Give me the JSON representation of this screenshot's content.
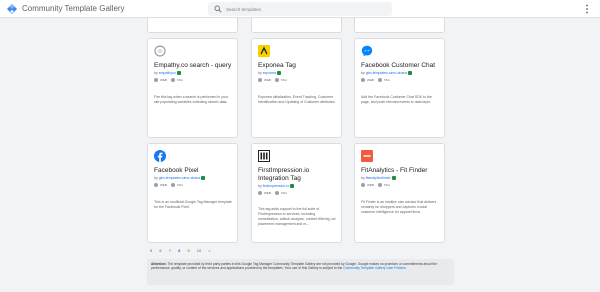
{
  "header": {
    "title": "Community Template Gallery",
    "search_placeholder": "Search templates"
  },
  "cards": [
    {
      "title": "Empathy.co search - query",
      "by": "by",
      "author": "empathyco",
      "tags": [
        "WEB",
        "TAG"
      ],
      "description": "Fire this tag when a search is performed in your site populating variables collecting search data.",
      "icon": "empathy-logo-icon"
    },
    {
      "title": "Exponea Tag",
      "by": "by",
      "author": "exponea",
      "tags": [
        "WEB",
        "TAG"
      ],
      "description": "Exponea initialization, Event Tracking, Customer identification and Updating of Customer attributes.",
      "icon": "exponea-logo-icon"
    },
    {
      "title": "Facebook Customer Chat",
      "by": "by",
      "author": "gtm-templates-simo-ahava",
      "tags": [
        "WEB",
        "TAG"
      ],
      "description": "Add the Facebook Customer Chat SDK to the page, and push relevant events to data layer.",
      "icon": "messenger-icon"
    },
    {
      "title": "Facebook Pixel",
      "by": "by",
      "author": "gtm-templates-simo-ahava",
      "tags": [
        "WEB",
        "TAG"
      ],
      "description": "This is an unofficial Google Tag Manager template for the Facebook Pixel.",
      "icon": "facebook-icon"
    },
    {
      "title": "FirstImpression.io Integration Tag",
      "by": "by",
      "author": "firstimpression-io",
      "tags": [
        "WEB",
        "TAG"
      ],
      "description": "This tag adds support to the full suite of FirstImpression.io services, including monetization, adtech analysis, content filtering, ad placement management and m...",
      "icon": "firstimpression-logo-icon"
    },
    {
      "title": "FitAnalytics - Fit Finder",
      "by": "by",
      "author": "fitanalyticsfinder",
      "tags": [
        "WEB",
        "TAG"
      ],
      "description": "Fit Finder is an intuitive size advisor that delivers certainty for shoppers and captures crucial customer intelligence for apparel firms.",
      "icon": "fitanalytics-logo-icon"
    }
  ],
  "pagination": [
    "5",
    "6",
    "7",
    "8",
    "9",
    "10",
    ">"
  ],
  "pagination_current": "8",
  "notice": {
    "label": "Attention:",
    "text": "The template provided by third party parties in this Google Tag Manager Community Template Gallery are not provided by Google. Google makes no promises or commitments about the performance, quality, or content of the services and applications provided by the templates. Your use of this Gallery is subject to the",
    "link": "Community Template Gallery User Policies",
    "end": "."
  },
  "colors": {
    "accent": "#1a73e8",
    "verified": "#1e8e3e",
    "exponea": "#f7d200",
    "messenger": "#0084ff",
    "facebook": "#1877f2",
    "fitanalytics": "#f25c3c"
  }
}
